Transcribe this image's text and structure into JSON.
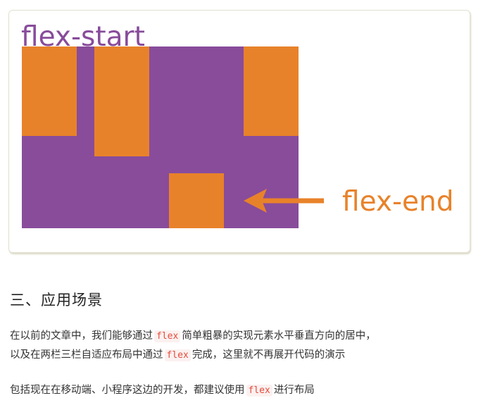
{
  "figure": {
    "start_label": "flex-start",
    "end_label": "flex-end",
    "colors": {
      "container": "#884c9b",
      "item": "#e8822a"
    }
  },
  "section": {
    "heading": "三、应用场景"
  },
  "paragraph1": {
    "line1_prefix": "在以前的文章中，我们能够通过",
    "line1_code": "flex",
    "line1_suffix": "简单粗暴的实现元素水平垂直方向的居中，",
    "line2_prefix": "以及在两栏三栏自适应布局中通过",
    "line2_code": "flex",
    "line2_suffix": "完成，这里就不再展开代码的演示"
  },
  "paragraph2": {
    "prefix": "包括现在在移动端、小程序这边的开发，都建议使用",
    "code": "flex",
    "suffix": "进行布局"
  }
}
